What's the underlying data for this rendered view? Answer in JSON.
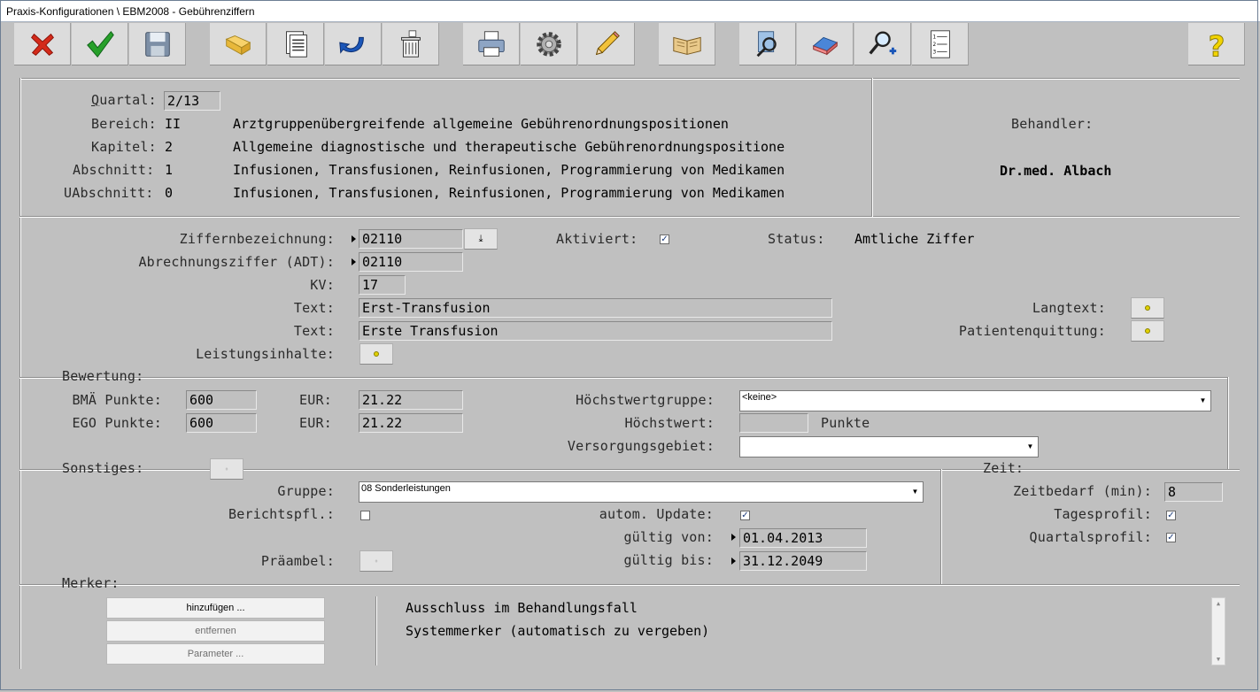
{
  "window": {
    "title": "Praxis-Konfigurationen \\ EBM2008 - Gebührenziffern"
  },
  "toolbar": {
    "buttons": [
      {
        "name": "cancel",
        "icon": "red-x-icon"
      },
      {
        "name": "ok",
        "icon": "green-check-icon"
      },
      {
        "name": "save",
        "icon": "floppy-disk-icon"
      },
      {
        "name": "folder",
        "icon": "folder-icon"
      },
      {
        "name": "copy",
        "icon": "copy-pages-icon"
      },
      {
        "name": "undo",
        "icon": "undo-arrow-icon"
      },
      {
        "name": "delete",
        "icon": "trash-icon"
      },
      {
        "name": "print",
        "icon": "printer-icon"
      },
      {
        "name": "settings",
        "icon": "gear-icon"
      },
      {
        "name": "edit",
        "icon": "pencil-icon"
      },
      {
        "name": "book",
        "icon": "book-icon"
      },
      {
        "name": "search",
        "icon": "search-page-icon"
      },
      {
        "name": "eraser",
        "icon": "eraser-icon"
      },
      {
        "name": "zoom-add",
        "icon": "magnifier-plus-icon"
      },
      {
        "name": "list",
        "icon": "numbered-list-icon"
      },
      {
        "name": "help",
        "icon": "help-question-icon"
      }
    ]
  },
  "header": {
    "quartal_label": "Quartal:",
    "quartal_value": "2/13",
    "bereich_label": "Bereich:",
    "bereich_code": "II",
    "bereich_text": "Arztgruppenübergreifende allgemeine Gebührenordnungspositionen",
    "kapitel_label": "Kapitel:",
    "kapitel_code": "2",
    "kapitel_text": "Allgemeine diagnostische und therapeutische Gebührenordnungspositione",
    "abschnitt_label": "Abschnitt:",
    "abschnitt_code": "1",
    "abschnitt_text": "Infusionen, Transfusionen, Reinfusionen, Programmierung von Medikamen",
    "uabschnitt_label": "UAbschnitt:",
    "uabschnitt_code": "0",
    "uabschnitt_text": "Infusionen, Transfusionen, Reinfusionen, Programmierung von Medikamen",
    "behandler_label": "Behandler:",
    "behandler_value": "Dr.med. Albach"
  },
  "ziffer": {
    "bezeichnung_label": "Ziffernbezeichnung:",
    "bezeichnung_value": "02110",
    "adt_label": "Abrechnungsziffer (ADT):",
    "adt_value": "02110",
    "kv_label": "KV:",
    "kv_value": "17",
    "text1_label": "Text:",
    "text1_value": "Erst-Transfusion",
    "text2_label": "Text:",
    "text2_value": "Erste Transfusion",
    "leistung_label": "Leistungsinhalte:",
    "aktiviert_label": "Aktiviert:",
    "aktiviert_checked": true,
    "status_label": "Status:",
    "status_value": "Amtliche Ziffer",
    "langtext_label": "Langtext:",
    "patientenquittung_label": "Patientenquittung:"
  },
  "bewertung": {
    "section_label": "Bewertung:",
    "bma_label": "BMÄ Punkte:",
    "bma_value": "600",
    "ego_label": "EGO Punkte:",
    "ego_value": "600",
    "eur1_label": "EUR:",
    "eur1_value": "21.22",
    "eur2_label": "EUR:",
    "eur2_value": "21.22",
    "hoechstwertgruppe_label": "Höchstwertgruppe:",
    "hoechstwertgruppe_value": "<keine>",
    "hoechstwert_label": "Höchstwert:",
    "hoechstwert_value": "",
    "punkte_label": "Punkte",
    "versorgung_label": "Versorgungsgebiet:",
    "versorgung_value": ""
  },
  "sonstiges": {
    "section_label": "Sonstiges:",
    "gruppe_label": "Gruppe:",
    "gruppe_value": "08 Sonderleistungen",
    "bericht_label": "Berichtspfl.:",
    "bericht_checked": false,
    "autoupdate_label": "autom. Update:",
    "autoupdate_checked": true,
    "von_label": "gültig von:",
    "von_value": "01.04.2013",
    "bis_label": "gültig bis:",
    "bis_value": "31.12.2049",
    "praeambel_label": "Präambel:"
  },
  "zeit": {
    "section_label": "Zeit:",
    "bedarf_label": "Zeitbedarf (min):",
    "bedarf_value": "8",
    "tagesprofil_label": "Tagesprofil:",
    "tagesprofil_checked": true,
    "quartalsprofil_label": "Quartalsprofil:",
    "quartalsprofil_checked": true
  },
  "merker": {
    "section_label": "Merker:",
    "add_button": "hinzufügen ...",
    "remove_button": "entfernen",
    "param_button": "Parameter ...",
    "items": [
      "Ausschluss im Behandlungsfall",
      "Systemmerker (automatisch zu vergeben)"
    ]
  }
}
